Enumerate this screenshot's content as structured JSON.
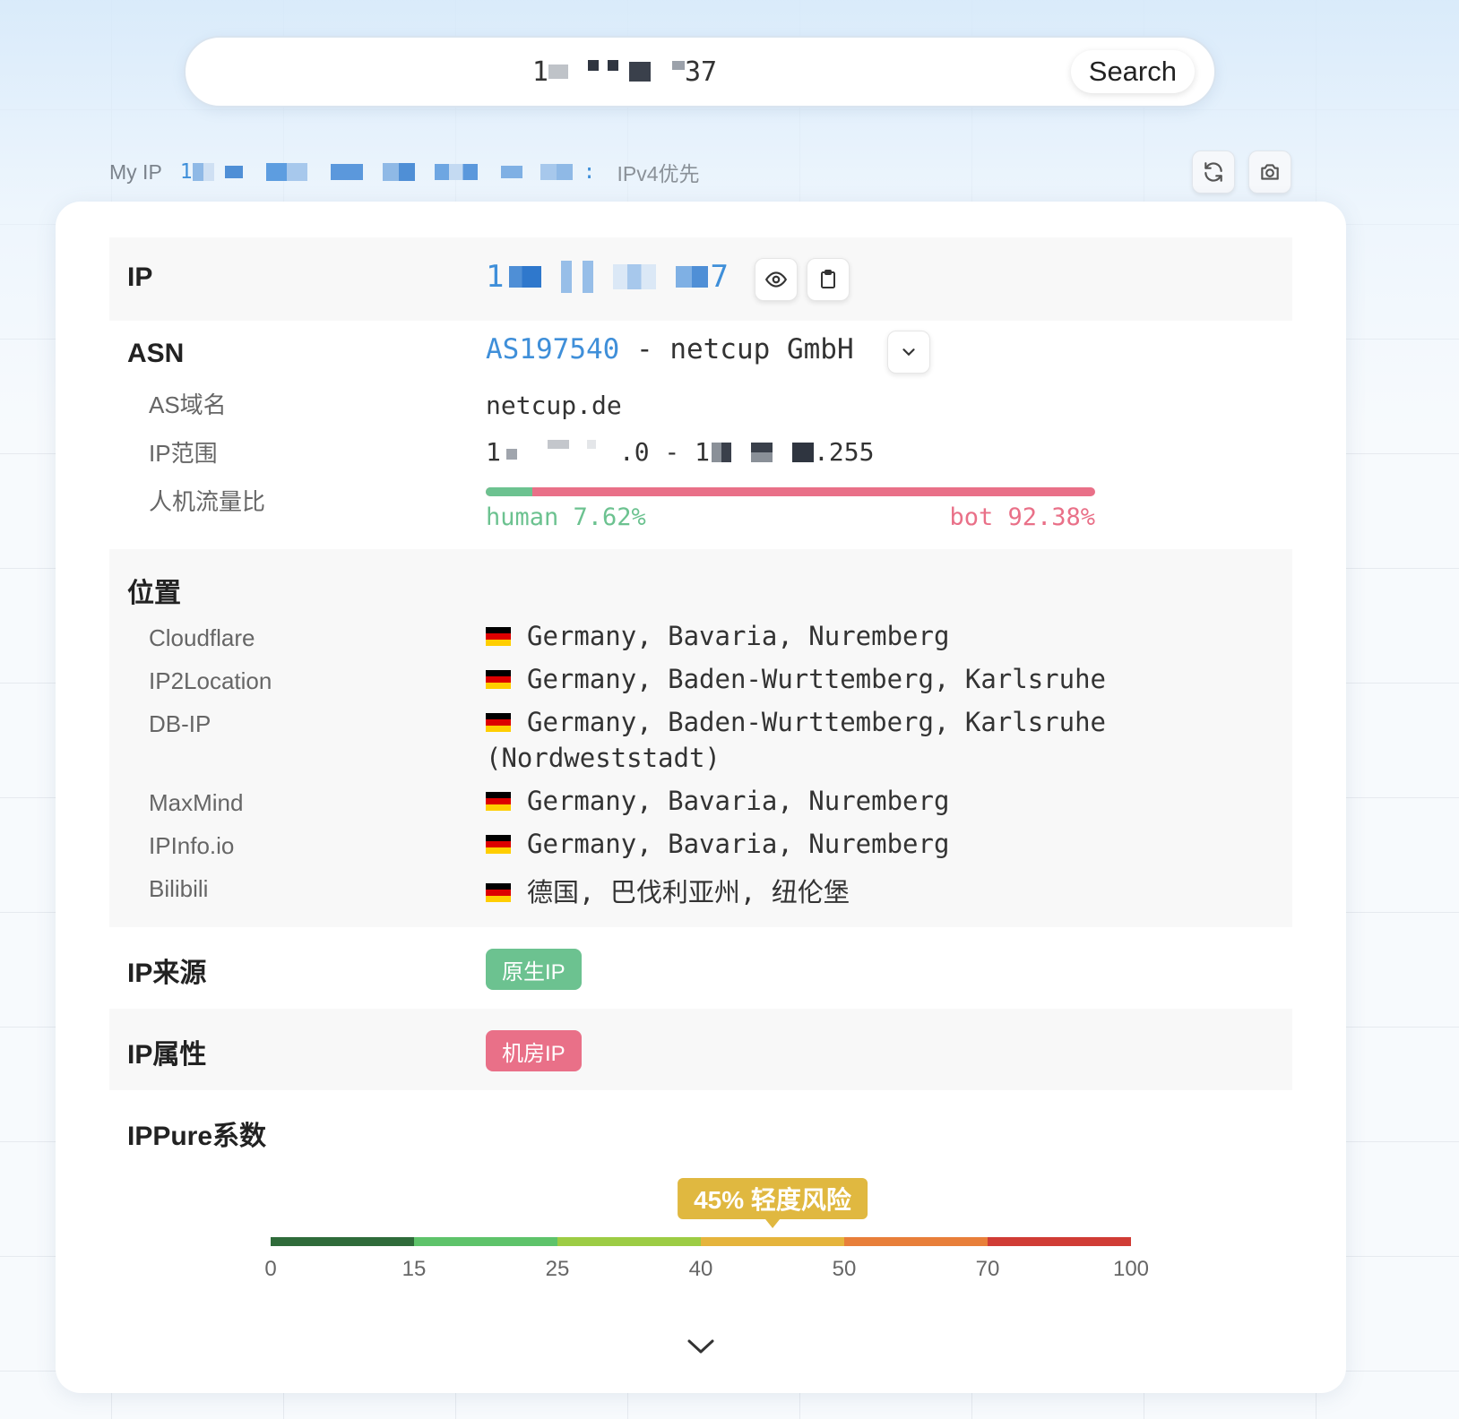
{
  "search": {
    "value_prefix": "1",
    "value_suffix": "37",
    "button_label": "Search"
  },
  "my_ip": {
    "label": "My IP",
    "value_prefix": "1",
    "value_suffix": ":",
    "preference": "IPv4优先"
  },
  "toolbar": {
    "refresh_icon": "refresh-icon",
    "camera_icon": "camera-icon"
  },
  "ip": {
    "label": "IP",
    "value_prefix": "1",
    "value_suffix": "7",
    "eye_icon": "eye-icon",
    "copy_icon": "clipboard-icon"
  },
  "asn": {
    "label": "ASN",
    "number": "AS197540",
    "separator": " - ",
    "org": "netcup GmbH",
    "expand_icon": "chevron-down-icon",
    "domain_label": "AS域名",
    "domain_value": "netcup.de",
    "range_label": "IP范围",
    "range_start_prefix": "1",
    "range_mid": ".0 - 1",
    "range_end_suffix": ".255",
    "traffic_label": "人机流量比",
    "human_text": "human 7.62%",
    "bot_text": "bot 92.38%",
    "human_percent": 7.62,
    "bot_percent": 92.38
  },
  "location": {
    "label": "位置",
    "sources": [
      {
        "name": "Cloudflare",
        "value": "Germany, Bavaria, Nuremberg"
      },
      {
        "name": "IP2Location",
        "value": "Germany, Baden-Wurttemberg, Karlsruhe"
      },
      {
        "name": "DB-IP",
        "value": "Germany, Baden-Wurttemberg, Karlsruhe",
        "value_cont": "(Nordweststadt)"
      },
      {
        "name": "MaxMind",
        "value": "Germany, Bavaria, Nuremberg"
      },
      {
        "name": "IPInfo.io",
        "value": "Germany, Bavaria, Nuremberg"
      },
      {
        "name": "Bilibili",
        "value": "德国, 巴伐利亚州, 纽伦堡"
      }
    ]
  },
  "source": {
    "label": "IP来源",
    "badge": "原生IP",
    "badge_color": "#6cc290"
  },
  "attribute": {
    "label": "IP属性",
    "badge": "机房IP",
    "badge_color": "#e97088"
  },
  "purity": {
    "label": "IPPure系数",
    "score": 45,
    "tag": "45% 轻度风险",
    "tag_color": "#e0b840",
    "ticks": [
      "0",
      "15",
      "25",
      "40",
      "50",
      "70",
      "100"
    ],
    "segment_colors": [
      "#2f6b3a",
      "#5ec36a",
      "#9ccc44",
      "#e5b43c",
      "#e87f3a",
      "#d03c35"
    ]
  },
  "footer": {
    "expand_icon": "chevron-down-icon"
  }
}
